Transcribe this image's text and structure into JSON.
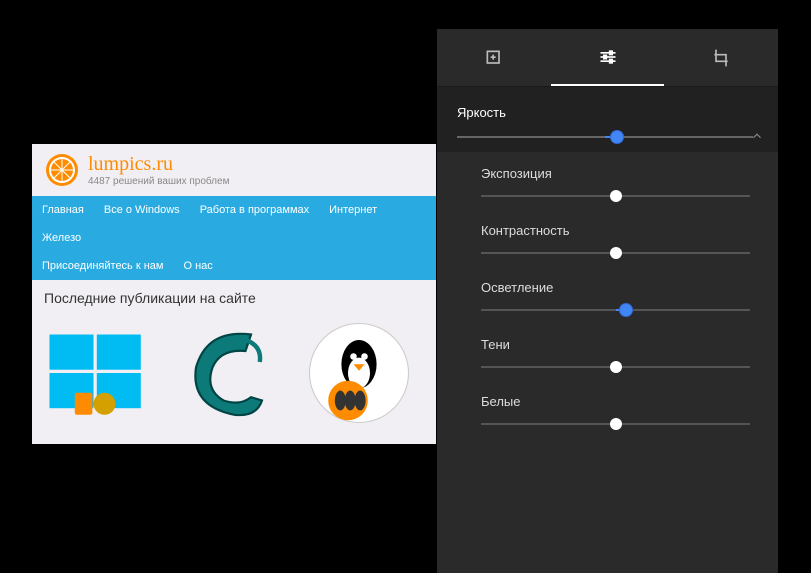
{
  "preview": {
    "site_title": "lumpics.ru",
    "tagline": "4487 решений ваших проблем",
    "nav": [
      "Главная",
      "Все о Windows",
      "Работа в программах",
      "Интернет",
      "Железо",
      "Присоединяйтесь к нам",
      "О нас"
    ],
    "content_title": "Последние публикации на сайте"
  },
  "editor": {
    "tabs": {
      "filters": "filters",
      "adjust": "adjust",
      "crop": "crop",
      "active": "adjust"
    },
    "sliders": {
      "brightness": {
        "label": "Яркость",
        "value": 52,
        "accent": true
      },
      "exposure": {
        "label": "Экспозиция",
        "value": 50
      },
      "contrast": {
        "label": "Контрастность",
        "value": 50
      },
      "highlights": {
        "label": "Осветление",
        "value": 52,
        "accent": true
      },
      "shadows": {
        "label": "Тени",
        "value": 50
      },
      "whites": {
        "label": "Белые",
        "value": 50
      }
    }
  }
}
